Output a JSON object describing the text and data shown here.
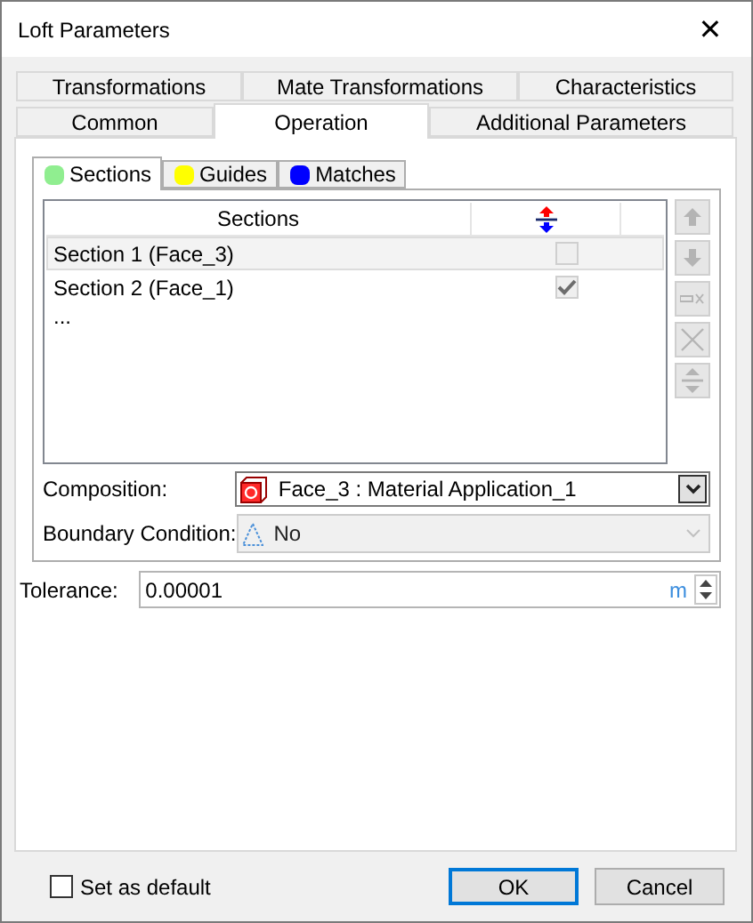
{
  "window": {
    "title": "Loft Parameters",
    "close": "✕"
  },
  "tab_rows": [
    [
      {
        "label": "Transformations",
        "selected": false
      },
      {
        "label": "Mate Transformations",
        "selected": false
      },
      {
        "label": "Characteristics",
        "selected": false
      }
    ],
    [
      {
        "label": "Common",
        "selected": false
      },
      {
        "label": "Operation",
        "selected": true
      },
      {
        "label": "Additional Parameters",
        "selected": false
      }
    ]
  ],
  "subtabs": [
    {
      "label": "Sections",
      "color": "#90ee90",
      "selected": true
    },
    {
      "label": "Guides",
      "color": "#ffff00",
      "selected": false
    },
    {
      "label": "Matches",
      "color": "#0000ff",
      "selected": false
    }
  ],
  "grid": {
    "columns": [
      "Sections"
    ],
    "rows": [
      {
        "name": "Section 1 (Face_3)",
        "checked": false,
        "selected": true
      },
      {
        "name": "Section 2 (Face_1)",
        "checked": true,
        "selected": false
      }
    ],
    "more": "..."
  },
  "side_buttons": [
    {
      "kind": "up",
      "disabled": true
    },
    {
      "kind": "down",
      "disabled": true
    },
    {
      "kind": "remove",
      "disabled": true
    },
    {
      "kind": "delete",
      "disabled": true
    },
    {
      "kind": "swap",
      "disabled": true
    }
  ],
  "composition": {
    "label": "Composition:",
    "value": "Face_3 : Material Application_1",
    "disabled": false
  },
  "boundary": {
    "label": "Boundary Condition:",
    "value": "No",
    "disabled": true
  },
  "tolerance": {
    "label": "Tolerance:",
    "value": "0.00001",
    "unit": "m"
  },
  "set_default": {
    "label": "Set as default",
    "checked": false
  },
  "buttons": [
    {
      "label": "OK",
      "default": true
    },
    {
      "label": "Cancel",
      "default": false
    }
  ]
}
